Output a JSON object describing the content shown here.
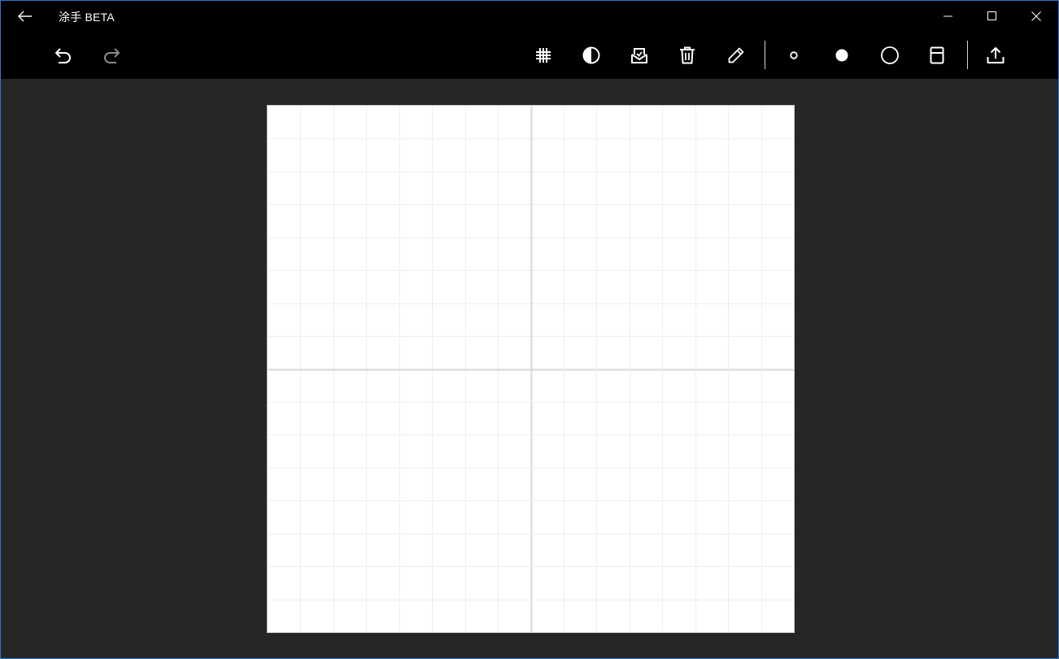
{
  "app": {
    "title": "涂手 BETA"
  },
  "titlebar": {
    "back_icon": "back-arrow-icon",
    "controls": [
      "minimize-icon",
      "maximize-icon",
      "close-icon"
    ]
  },
  "toolbar": {
    "left_tools": [
      "undo-icon",
      "redo-icon"
    ],
    "right_tools": [
      "grid-icon",
      "contrast-icon",
      "save-image-icon",
      "trash-icon",
      "pencil-icon",
      "small-dot-icon",
      "large-dot-icon",
      "circle-outline-icon",
      "background-toggle-icon",
      "share-icon"
    ]
  },
  "colors": {
    "titlebar_bg": "#000000",
    "workspace_bg": "#262626",
    "canvas_bg": "#ffffff",
    "grid_minor": "#eeeeee",
    "grid_major": "#dddddd",
    "window_border": "#2b79c9",
    "icon": "#ffffff",
    "icon_disabled": "#8a8a8a"
  }
}
